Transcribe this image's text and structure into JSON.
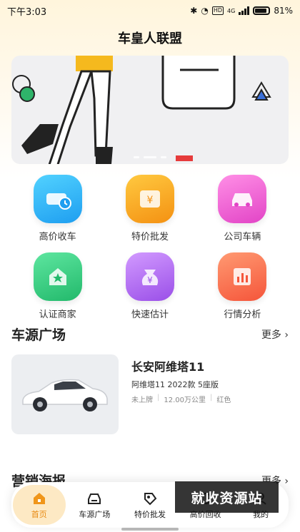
{
  "status_bar": {
    "time": "下午3:03",
    "network": "4G",
    "hd": "HD",
    "battery": "81%"
  },
  "app": {
    "title": "车皇人联盟"
  },
  "banner": {
    "slides": 3,
    "active_index": 1
  },
  "quick_actions": [
    {
      "label": "高价收车",
      "icon": "car-buy-icon",
      "color": "#2fb6f5"
    },
    {
      "label": "特价批发",
      "icon": "ticket-icon",
      "color": "#f8a51e"
    },
    {
      "label": "公司车辆",
      "icon": "car-icon",
      "color": "#f45fd2"
    },
    {
      "label": "认证商家",
      "icon": "shop-star-icon",
      "color": "#35c97f"
    },
    {
      "label": "快速估计",
      "icon": "money-bag-icon",
      "color": "#b26cf0"
    },
    {
      "label": "行情分析",
      "icon": "chart-icon",
      "color": "#ff7451"
    }
  ],
  "car_source": {
    "title": "车源广场",
    "more": "更多",
    "card": {
      "name": "长安阿维塔11",
      "model": "阿维塔11 2022款 5座版",
      "tags": [
        "未上牌",
        "12.00万公里",
        "红色"
      ]
    }
  },
  "marketing": {
    "title": "营销海报",
    "more": "更多"
  },
  "bottom_nav": [
    {
      "label": "首页",
      "icon": "home-icon",
      "active": true
    },
    {
      "label": "车源广场",
      "icon": "car-source-icon",
      "active": false
    },
    {
      "label": "特价批发",
      "icon": "tag-icon",
      "active": false
    },
    {
      "label": "高价回收",
      "icon": "recycle-icon",
      "active": false
    },
    {
      "label": "我的",
      "icon": "user-icon",
      "active": false
    }
  ],
  "watermark": "就收资源站"
}
